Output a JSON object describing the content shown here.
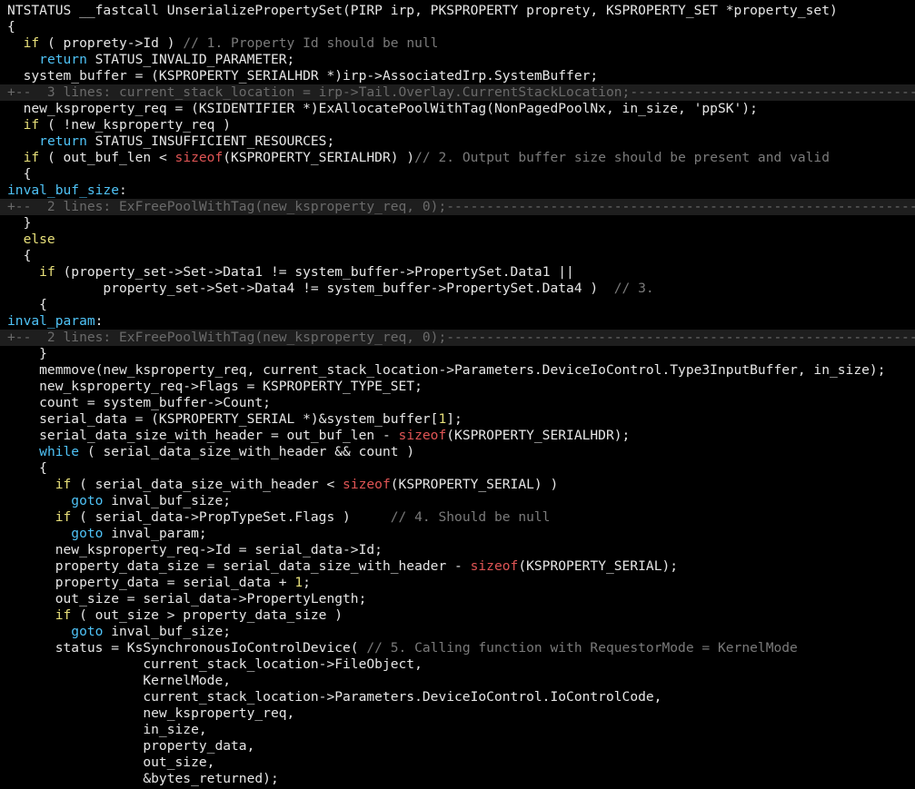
{
  "editor": {
    "lines": [
      {
        "kind": "code",
        "segments": [
          {
            "t": "NTSTATUS __fastcall UnserializePropertySet(PIRP irp, PKSPROPERTY proprety, KSPROPERTY_SET *property_set)",
            "c": "plain"
          }
        ]
      },
      {
        "kind": "code",
        "segments": [
          {
            "t": "{",
            "c": "plain"
          }
        ]
      },
      {
        "kind": "code",
        "segments": [
          {
            "t": "  ",
            "c": "plain"
          },
          {
            "t": "if",
            "c": "kw"
          },
          {
            "t": " ( proprety->Id ) ",
            "c": "plain"
          },
          {
            "t": "// 1. Property Id should be null",
            "c": "cmt"
          }
        ]
      },
      {
        "kind": "code",
        "segments": [
          {
            "t": "    ",
            "c": "plain"
          },
          {
            "t": "return",
            "c": "kw2"
          },
          {
            "t": " STATUS_INVALID_PARAMETER;",
            "c": "plain"
          }
        ]
      },
      {
        "kind": "code",
        "segments": [
          {
            "t": "  system_buffer = (KSPROPERTY_SERIALHDR *)irp->AssociatedIrp.SystemBuffer;",
            "c": "plain"
          }
        ]
      },
      {
        "kind": "fold",
        "segments": [
          {
            "t": "+--  3 lines: current_stack_location = irp->Tail.Overlay.CurrentStackLocation;-------------------------------------------------",
            "c": "plain"
          }
        ]
      },
      {
        "kind": "code",
        "segments": [
          {
            "t": "  new_ksproperty_req = (KSIDENTIFIER *)ExAllocatePoolWithTag(NonPagedPoolNx, in_size, 'ppSK');",
            "c": "plain"
          }
        ]
      },
      {
        "kind": "code",
        "segments": [
          {
            "t": "  ",
            "c": "plain"
          },
          {
            "t": "if",
            "c": "kw"
          },
          {
            "t": " ( !new_ksproperty_req )",
            "c": "plain"
          }
        ]
      },
      {
        "kind": "code",
        "segments": [
          {
            "t": "    ",
            "c": "plain"
          },
          {
            "t": "return",
            "c": "kw2"
          },
          {
            "t": " STATUS_INSUFFICIENT_RESOURCES;",
            "c": "plain"
          }
        ]
      },
      {
        "kind": "code",
        "segments": [
          {
            "t": "  ",
            "c": "plain"
          },
          {
            "t": "if",
            "c": "kw"
          },
          {
            "t": " ( out_buf_len < ",
            "c": "plain"
          },
          {
            "t": "sizeof",
            "c": "red"
          },
          {
            "t": "(KSPROPERTY_SERIALHDR) )",
            "c": "plain"
          },
          {
            "t": "// 2. Output buffer size should be present and valid",
            "c": "cmt"
          }
        ]
      },
      {
        "kind": "code",
        "segments": [
          {
            "t": "  {",
            "c": "plain"
          }
        ]
      },
      {
        "kind": "code",
        "segments": [
          {
            "t": "inval_buf_size",
            "c": "label"
          },
          {
            "t": ":",
            "c": "plain"
          }
        ]
      },
      {
        "kind": "fold",
        "segments": [
          {
            "t": "+--  2 lines: ExFreePoolWithTag(new_ksproperty_req, 0);---------------------------------------------------------------------",
            "c": "plain"
          }
        ]
      },
      {
        "kind": "code",
        "segments": [
          {
            "t": "  }",
            "c": "plain"
          }
        ]
      },
      {
        "kind": "code",
        "segments": [
          {
            "t": "  ",
            "c": "plain"
          },
          {
            "t": "else",
            "c": "kw"
          }
        ]
      },
      {
        "kind": "code",
        "segments": [
          {
            "t": "  {",
            "c": "plain"
          }
        ]
      },
      {
        "kind": "code",
        "segments": [
          {
            "t": "    ",
            "c": "plain"
          },
          {
            "t": "if",
            "c": "kw"
          },
          {
            "t": " (property_set->Set->Data1 != system_buffer->PropertySet.Data1 ||",
            "c": "plain"
          }
        ]
      },
      {
        "kind": "code",
        "segments": [
          {
            "t": "            property_set->Set->Data4 != system_buffer->PropertySet.Data4 )  ",
            "c": "plain"
          },
          {
            "t": "// 3.",
            "c": "cmt"
          }
        ]
      },
      {
        "kind": "code",
        "segments": [
          {
            "t": "    {",
            "c": "plain"
          }
        ]
      },
      {
        "kind": "code",
        "segments": [
          {
            "t": "inval_param",
            "c": "label"
          },
          {
            "t": ":",
            "c": "plain"
          }
        ]
      },
      {
        "kind": "fold",
        "segments": [
          {
            "t": "+--  2 lines: ExFreePoolWithTag(new_ksproperty_req, 0);---------------------------------------------------------------------",
            "c": "plain"
          }
        ]
      },
      {
        "kind": "code",
        "segments": [
          {
            "t": "    }",
            "c": "plain"
          }
        ]
      },
      {
        "kind": "code",
        "segments": [
          {
            "t": "    memmove(new_ksproperty_req, current_stack_location->Parameters.DeviceIoControl.Type3InputBuffer, in_size);",
            "c": "plain"
          }
        ]
      },
      {
        "kind": "code",
        "segments": [
          {
            "t": "    new_ksproperty_req->Flags = KSPROPERTY_TYPE_SET;",
            "c": "plain"
          }
        ]
      },
      {
        "kind": "code",
        "segments": [
          {
            "t": "    count = system_buffer->Count;",
            "c": "plain"
          }
        ]
      },
      {
        "kind": "code",
        "segments": [
          {
            "t": "    serial_data = (KSPROPERTY_SERIAL *)&system_buffer[",
            "c": "plain"
          },
          {
            "t": "1",
            "c": "num"
          },
          {
            "t": "];",
            "c": "plain"
          }
        ]
      },
      {
        "kind": "code",
        "segments": [
          {
            "t": "    serial_data_size_with_header = out_buf_len - ",
            "c": "plain"
          },
          {
            "t": "sizeof",
            "c": "red"
          },
          {
            "t": "(KSPROPERTY_SERIALHDR);",
            "c": "plain"
          }
        ]
      },
      {
        "kind": "code",
        "segments": [
          {
            "t": "    ",
            "c": "plain"
          },
          {
            "t": "while",
            "c": "kw2"
          },
          {
            "t": " ( serial_data_size_with_header && count )",
            "c": "plain"
          }
        ]
      },
      {
        "kind": "code",
        "segments": [
          {
            "t": "    {",
            "c": "plain"
          }
        ]
      },
      {
        "kind": "code",
        "segments": [
          {
            "t": "      ",
            "c": "plain"
          },
          {
            "t": "if",
            "c": "kw"
          },
          {
            "t": " ( serial_data_size_with_header < ",
            "c": "plain"
          },
          {
            "t": "sizeof",
            "c": "red"
          },
          {
            "t": "(KSPROPERTY_SERIAL) )",
            "c": "plain"
          }
        ]
      },
      {
        "kind": "code",
        "segments": [
          {
            "t": "        ",
            "c": "plain"
          },
          {
            "t": "goto",
            "c": "kw2"
          },
          {
            "t": " inval_buf_size;",
            "c": "plain"
          }
        ]
      },
      {
        "kind": "code",
        "segments": [
          {
            "t": "      ",
            "c": "plain"
          },
          {
            "t": "if",
            "c": "kw"
          },
          {
            "t": " ( serial_data->PropTypeSet.Flags )     ",
            "c": "plain"
          },
          {
            "t": "// 4. Should be null",
            "c": "cmt"
          }
        ]
      },
      {
        "kind": "code",
        "segments": [
          {
            "t": "        ",
            "c": "plain"
          },
          {
            "t": "goto",
            "c": "kw2"
          },
          {
            "t": " inval_param;",
            "c": "plain"
          }
        ]
      },
      {
        "kind": "code",
        "segments": [
          {
            "t": "      new_ksproperty_req->Id = serial_data->Id;",
            "c": "plain"
          }
        ]
      },
      {
        "kind": "code",
        "segments": [
          {
            "t": "      property_data_size = serial_data_size_with_header - ",
            "c": "plain"
          },
          {
            "t": "sizeof",
            "c": "red"
          },
          {
            "t": "(KSPROPERTY_SERIAL);",
            "c": "plain"
          }
        ]
      },
      {
        "kind": "code",
        "segments": [
          {
            "t": "      property_data = serial_data + ",
            "c": "plain"
          },
          {
            "t": "1",
            "c": "num"
          },
          {
            "t": ";",
            "c": "plain"
          }
        ]
      },
      {
        "kind": "code",
        "segments": [
          {
            "t": "      out_size = serial_data->PropertyLength;",
            "c": "plain"
          }
        ]
      },
      {
        "kind": "code",
        "segments": [
          {
            "t": "      ",
            "c": "plain"
          },
          {
            "t": "if",
            "c": "kw"
          },
          {
            "t": " ( out_size > property_data_size )",
            "c": "plain"
          }
        ]
      },
      {
        "kind": "code",
        "segments": [
          {
            "t": "        ",
            "c": "plain"
          },
          {
            "t": "goto",
            "c": "kw2"
          },
          {
            "t": " inval_buf_size;",
            "c": "plain"
          }
        ]
      },
      {
        "kind": "code",
        "segments": [
          {
            "t": "      status = KsSynchronousIoControlDevice( ",
            "c": "plain"
          },
          {
            "t": "// 5. Calling function with RequestorMode = KernelMode",
            "c": "cmt"
          }
        ]
      },
      {
        "kind": "code",
        "segments": [
          {
            "t": "                 current_stack_location->FileObject,",
            "c": "plain"
          }
        ]
      },
      {
        "kind": "code",
        "segments": [
          {
            "t": "                 KernelMode,",
            "c": "plain"
          }
        ]
      },
      {
        "kind": "code",
        "segments": [
          {
            "t": "                 current_stack_location->Parameters.DeviceIoControl.IoControlCode,",
            "c": "plain"
          }
        ]
      },
      {
        "kind": "code",
        "segments": [
          {
            "t": "                 new_ksproperty_req,",
            "c": "plain"
          }
        ]
      },
      {
        "kind": "code",
        "segments": [
          {
            "t": "                 in_size,",
            "c": "plain"
          }
        ]
      },
      {
        "kind": "code",
        "segments": [
          {
            "t": "                 property_data,",
            "c": "plain"
          }
        ]
      },
      {
        "kind": "code",
        "segments": [
          {
            "t": "                 out_size,",
            "c": "plain"
          }
        ]
      },
      {
        "kind": "code",
        "segments": [
          {
            "t": "                 &bytes_returned);",
            "c": "plain"
          }
        ]
      }
    ]
  }
}
